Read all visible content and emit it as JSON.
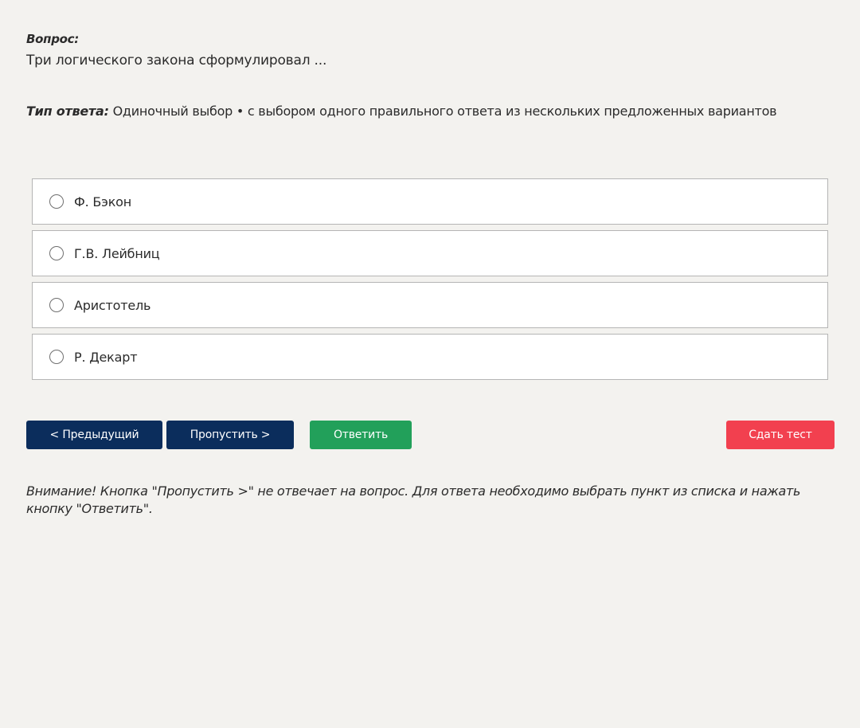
{
  "question": {
    "label": "Вопрос:",
    "text": "Три логического закона сформулировал ..."
  },
  "answer_type": {
    "label": "Тип ответа:",
    "value": "Одиночный выбор • с выбором одного правильного ответа из нескольких предложенных вариантов"
  },
  "options": [
    {
      "label": "Ф. Бэкон",
      "selected": false
    },
    {
      "label": "Г.В. Лейбниц",
      "selected": false
    },
    {
      "label": "Аристотель",
      "selected": false
    },
    {
      "label": "Р. Декарт",
      "selected": false
    }
  ],
  "buttons": {
    "prev": "< Предыдущий",
    "skip": "Пропустить >",
    "answer": "Ответить",
    "submit": "Сдать тест"
  },
  "notice": "Внимание! Кнопка \"Пропустить >\" не отвечает на вопрос. Для ответа необходимо выбрать пункт из списка и нажать кнопку \"Ответить\".",
  "colors": {
    "background": "#f3f2ef",
    "nav_button": "#0b2d5c",
    "answer_button": "#22a05a",
    "submit_button": "#f2404f"
  }
}
